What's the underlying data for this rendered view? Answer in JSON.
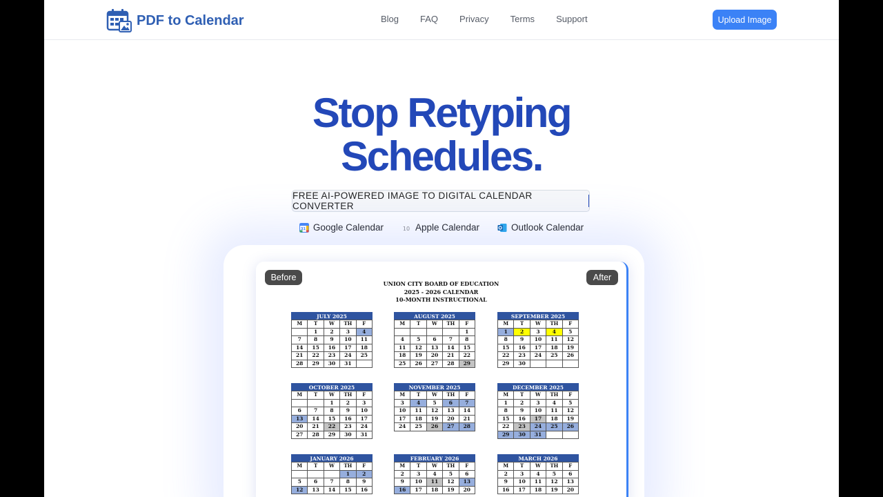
{
  "header": {
    "brand": "PDF to Calendar",
    "nav": [
      "Blog",
      "FAQ",
      "Privacy",
      "Terms",
      "Support"
    ],
    "upload_label": "Upload Image"
  },
  "hero": {
    "line1": "Stop Retyping",
    "line2": "Schedules.",
    "tagline": "FREE AI-POWERED IMAGE TO DIGITAL CALENDAR CONVERTER"
  },
  "providers": [
    {
      "name": "Google Calendar",
      "icon": "google-calendar-icon"
    },
    {
      "name": "Apple Calendar",
      "icon": "apple-calendar-icon",
      "icon_text": "10"
    },
    {
      "name": "Outlook Calendar",
      "icon": "outlook-calendar-icon"
    }
  ],
  "preview": {
    "before_label": "Before",
    "after_label": "After",
    "doc_title": [
      "UNION CITY BOARD OF EDUCATION",
      "2025 - 2026 CALENDAR",
      "10-MONTH INSTRUCTIONAL"
    ],
    "weekday_headers": [
      "M",
      "T",
      "W",
      "TH",
      "F"
    ],
    "months": [
      {
        "name": "JULY 2025",
        "cells": [
          "",
          "1",
          "2",
          "3",
          "4",
          "7",
          "8",
          "9",
          "10",
          "11",
          "14",
          "15",
          "16",
          "17",
          "18",
          "21",
          "22",
          "23",
          "24",
          "25",
          "28",
          "29",
          "30",
          "31",
          ""
        ],
        "blue": [
          "4"
        ],
        "grey": [],
        "yellow": []
      },
      {
        "name": "AUGUST 2025",
        "cells": [
          "",
          "",
          "",
          "",
          "1",
          "4",
          "5",
          "6",
          "7",
          "8",
          "11",
          "12",
          "13",
          "14",
          "15",
          "18",
          "19",
          "20",
          "21",
          "22",
          "25",
          "26",
          "27",
          "28",
          "29"
        ],
        "blue": [],
        "grey": [
          "29"
        ],
        "yellow": []
      },
      {
        "name": "SEPTEMBER 2025",
        "cells": [
          "1",
          "2",
          "3",
          "4",
          "5",
          "8",
          "9",
          "10",
          "11",
          "12",
          "15",
          "16",
          "17",
          "18",
          "19",
          "22",
          "23",
          "24",
          "25",
          "26",
          "29",
          "30",
          "",
          "",
          ""
        ],
        "blue": [
          "1"
        ],
        "grey": [],
        "yellow": [
          "2",
          "4"
        ]
      },
      {
        "name": "OCTOBER 2025",
        "cells": [
          "",
          "",
          "1",
          "2",
          "3",
          "6",
          "7",
          "8",
          "9",
          "10",
          "13",
          "14",
          "15",
          "16",
          "17",
          "20",
          "21",
          "22",
          "23",
          "24",
          "27",
          "28",
          "29",
          "30",
          "31"
        ],
        "blue": [
          "13"
        ],
        "grey": [
          "22"
        ],
        "yellow": []
      },
      {
        "name": "NOVEMBER 2025",
        "cells": [
          "3",
          "4",
          "5",
          "6",
          "7",
          "10",
          "11",
          "12",
          "13",
          "14",
          "17",
          "18",
          "19",
          "20",
          "21",
          "24",
          "25",
          "26",
          "27",
          "28"
        ],
        "blue": [
          "4",
          "6",
          "7",
          "27",
          "28"
        ],
        "grey": [
          "26"
        ],
        "yellow": []
      },
      {
        "name": "DECEMBER 2025",
        "cells": [
          "1",
          "2",
          "3",
          "4",
          "5",
          "8",
          "9",
          "10",
          "11",
          "12",
          "15",
          "16",
          "17",
          "18",
          "19",
          "22",
          "23",
          "24",
          "25",
          "26",
          "29",
          "30",
          "31",
          "",
          ""
        ],
        "blue": [
          "24",
          "25",
          "26",
          "29",
          "30",
          "31"
        ],
        "grey": [
          "17",
          "23"
        ],
        "yellow": []
      },
      {
        "name": "JANUARY 2026",
        "cells": [
          "",
          "",
          "",
          "1",
          "2",
          "5",
          "6",
          "7",
          "8",
          "9",
          "12",
          "13",
          "14",
          "15",
          "16"
        ],
        "blue": [
          "1",
          "2",
          "12"
        ],
        "grey": [],
        "yellow": []
      },
      {
        "name": "FEBRUARY 2026",
        "cells": [
          "2",
          "3",
          "4",
          "5",
          "6",
          "9",
          "10",
          "11",
          "12",
          "13",
          "16",
          "17",
          "18",
          "19",
          "20"
        ],
        "blue": [
          "13",
          "16"
        ],
        "grey": [
          "11"
        ],
        "yellow": []
      },
      {
        "name": "MARCH 2026",
        "cells": [
          "2",
          "3",
          "4",
          "5",
          "6",
          "9",
          "10",
          "11",
          "12",
          "13",
          "16",
          "17",
          "18",
          "19",
          "20"
        ],
        "blue": [],
        "grey": [],
        "yellow": []
      }
    ]
  }
}
